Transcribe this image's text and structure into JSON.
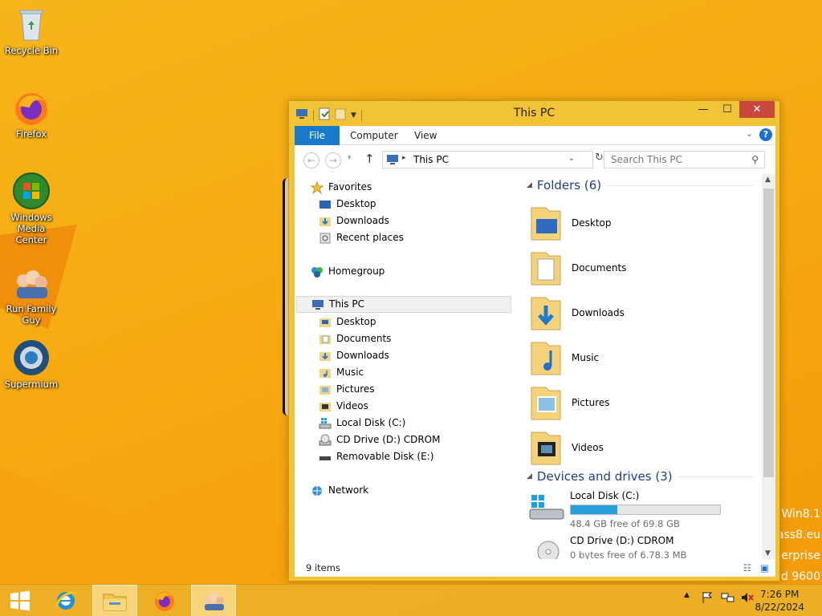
{
  "desktop": {
    "icons": [
      {
        "label": "Recycle Bin",
        "icon": "recycle-bin-icon"
      },
      {
        "label": "Firefox",
        "icon": "firefox-icon"
      },
      {
        "label": "Windows Media Center",
        "icon": "windows-media-center-icon"
      },
      {
        "label": "Run Family Guy",
        "icon": "family-guy-icon"
      },
      {
        "label": "Supermium",
        "icon": "supermium-icon"
      }
    ],
    "wallpaper_text": [
      "Win8.1",
      "ass8.eu",
      "erprise",
      "d 9600"
    ]
  },
  "window": {
    "title": "This PC",
    "ribbon": {
      "tabs": [
        "File",
        "Computer",
        "View"
      ]
    },
    "address": {
      "path": "This PC",
      "search_placeholder": "Search This PC"
    },
    "nav": {
      "favorites": {
        "label": "Favorites",
        "items": [
          "Desktop",
          "Downloads",
          "Recent places"
        ]
      },
      "homegroup": "Homegroup",
      "this_pc": {
        "label": "This PC",
        "items": [
          "Desktop",
          "Documents",
          "Downloads",
          "Music",
          "Pictures",
          "Videos",
          "Local Disk (C:)",
          "CD Drive (D:) CDROM",
          "Removable Disk (E:)"
        ]
      },
      "network": "Network"
    },
    "main": {
      "folders_header": "Folders (6)",
      "folders": [
        "Desktop",
        "Documents",
        "Downloads",
        "Music",
        "Pictures",
        "Videos"
      ],
      "devices_header": "Devices and drives (3)",
      "drives": [
        {
          "name": "Local Disk (C:)",
          "free": "48.4 GB free of 69.8 GB",
          "used_fraction": 0.31
        },
        {
          "name": "CD Drive (D:) CDROM",
          "free": "0 bytes free of 6.78.3 MB"
        }
      ]
    },
    "status": "9 items"
  },
  "taskbar": {
    "clock": {
      "time": "7:26 PM",
      "date": "8/22/2024"
    }
  },
  "colors": {
    "accent": "#1979ca",
    "wallpaper": "#f6a912",
    "drive_bar": "#26a0da"
  }
}
